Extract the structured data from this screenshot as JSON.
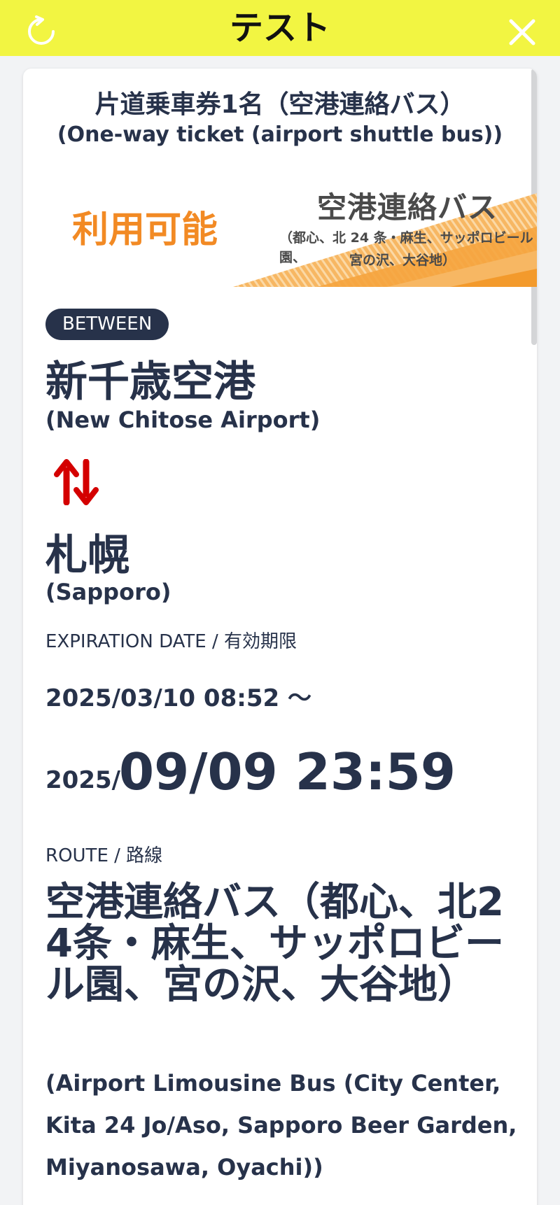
{
  "header": {
    "title": "テスト",
    "reload_icon": "reload-icon",
    "close_icon": "close-icon",
    "background_color": "#f2f542"
  },
  "ticket": {
    "title_ja": "片道乗車券1名（空港連絡バス）",
    "title_en": "(One-way ticket (airport shuttle bus))"
  },
  "banner": {
    "available": "利用可能",
    "service_name": "空港連絡バス",
    "service_sub_1": "（都心、北 24 条・麻生、サッポロビール園、",
    "service_sub_2": "宮の沢、大谷地）",
    "accent_color": "#f28a24"
  },
  "between": {
    "badge": "BETWEEN",
    "from_ja": "新千歳空港",
    "from_en": "(New Chitose Airport)",
    "swap_icon": "swap-arrows-icon",
    "to_ja": "札幌",
    "to_en": "(Sapporo)",
    "arrow_color": "#d40000"
  },
  "expiration": {
    "label_en": "EXPIRATION DATE",
    "label_sep": " / ",
    "label_ja": "有効期限",
    "start": "2025/03/10 08:52 〜",
    "end_year": "2025/",
    "end_date": "09/09 23:59"
  },
  "route": {
    "label_en": "ROUTE",
    "label_sep": " / ",
    "label_ja": "路線",
    "name_ja": "空港連絡バス（都心、北24条・麻生、サッポロビール園、宮の沢、大谷地）",
    "name_en": "(Airport Limousine Bus (City Center, Kita 24 Jo/Aso, Sapporo Beer Garden, Miyanosawa, Oyachi))"
  }
}
